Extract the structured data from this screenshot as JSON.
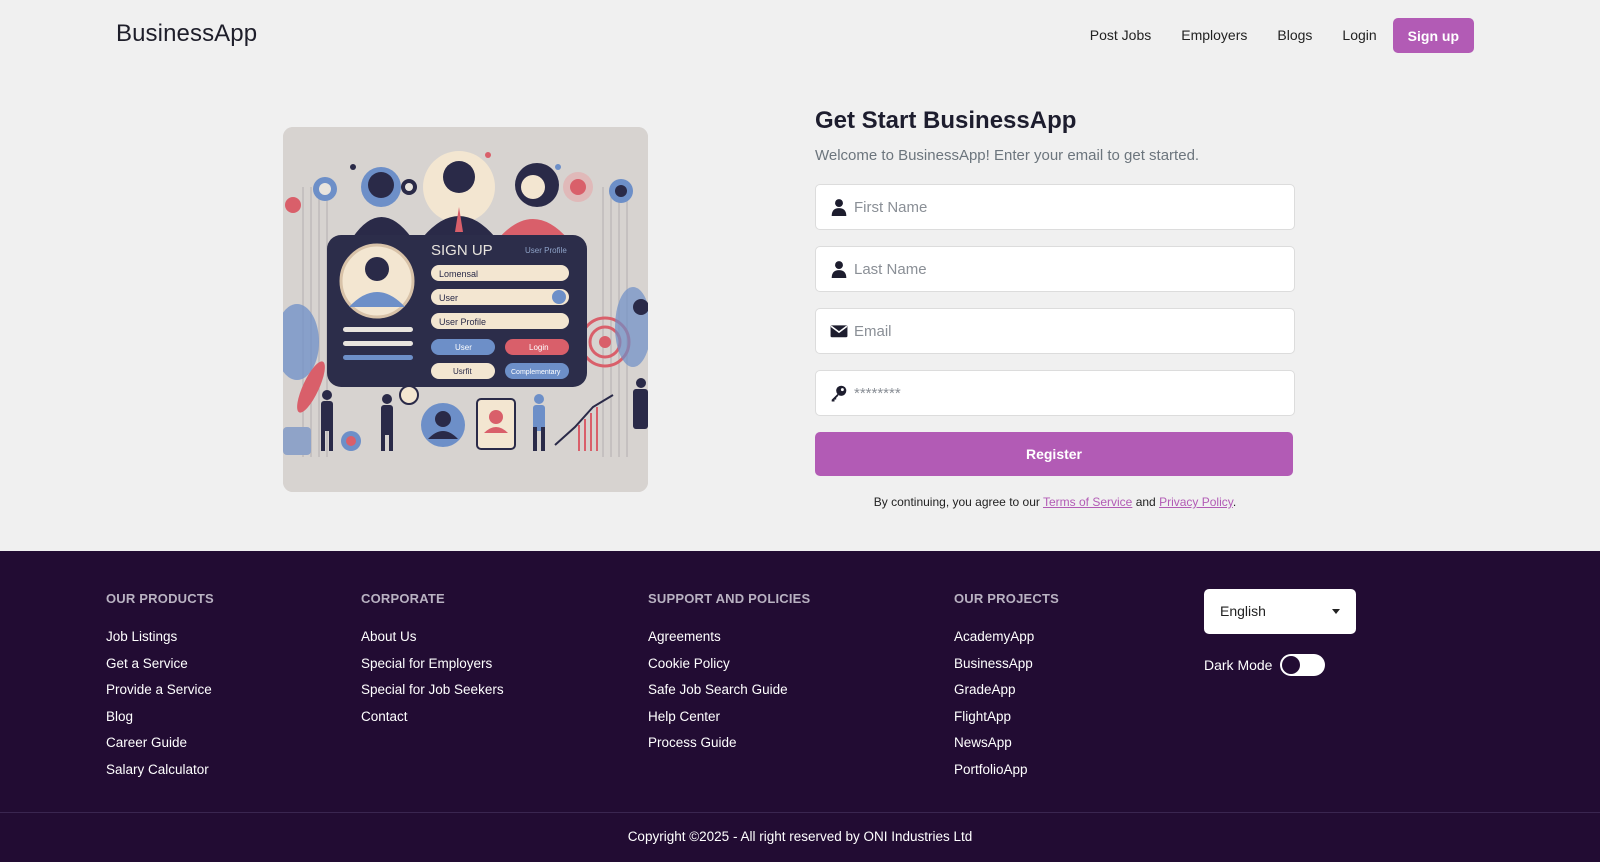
{
  "header": {
    "brand": "BusinessApp",
    "nav": [
      "Post Jobs",
      "Employers",
      "Blogs",
      "Login"
    ],
    "signup_label": "Sign up"
  },
  "hero": {
    "illustration": {
      "title": "SIGN UP",
      "subtitle": "User Profile",
      "field1": "Lomensal",
      "field2": "User",
      "field3": "User Profile",
      "btn_user": "User",
      "btn_login": "Login",
      "btn_userfit": "Usrfit",
      "btn_complementary": "Complementary"
    }
  },
  "form": {
    "title": "Get Start BusinessApp",
    "subtitle": "Welcome to BusinessApp! Enter your email to get started.",
    "first_name_placeholder": "First Name",
    "last_name_placeholder": "Last Name",
    "email_placeholder": "Email",
    "password_placeholder": "********",
    "register_label": "Register",
    "terms_prefix": "By continuing, you agree to our",
    "terms_link": "Terms of Service",
    "terms_and": "and",
    "privacy_link": "Privacy Policy",
    "terms_suffix": "."
  },
  "footer": {
    "columns": [
      {
        "title": "OUR PRODUCTS",
        "links": [
          "Job Listings",
          "Get a Service",
          "Provide a Service",
          "Blog",
          "Career Guide",
          "Salary Calculator"
        ]
      },
      {
        "title": "CORPORATE",
        "links": [
          "About Us",
          "Special for Employers",
          "Special for Job Seekers",
          "Contact"
        ]
      },
      {
        "title": "SUPPORT AND POLICIES",
        "links": [
          "Agreements",
          "Cookie Policy",
          "Safe Job Search Guide",
          "Help Center",
          "Process Guide"
        ]
      },
      {
        "title": "OUR PROJECTS",
        "links": [
          "AcademyApp",
          "BusinessApp",
          "GradeApp",
          "FlightApp",
          "NewsApp",
          "PortfolioApp"
        ]
      }
    ],
    "language": "English",
    "dark_mode_label": "Dark Mode",
    "dark_mode_on": false,
    "copyright": "Copyright ©2025 - All right reserved by ONI Industries Ltd"
  },
  "colors": {
    "accent": "#b25bb5",
    "footer_bg": "#220c33",
    "page_bg": "#f0f0f0"
  }
}
